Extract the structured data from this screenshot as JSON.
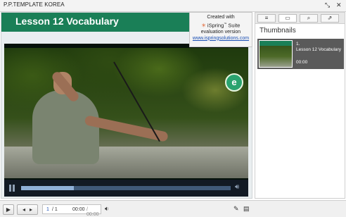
{
  "window": {
    "title": "P.P.TEMPLATE KOREA",
    "expand_icon": "expand-icon",
    "close_icon": "close-icon"
  },
  "slide": {
    "title": "Lesson 12 Vocabulary",
    "video_logo": "e"
  },
  "watermark": {
    "line1": "Created with",
    "brand": "iSpring",
    "brand_suffix": " Suite",
    "line3": "evaluation version",
    "link": "www.ispringsolutions.com"
  },
  "video": {
    "progress": 0.25,
    "pause_icon": "pause-icon",
    "volume_icon": "volume-icon"
  },
  "player": {
    "play_icon": "play-icon",
    "prev_icon": "prev-slide-icon",
    "next_icon": "next-slide-icon",
    "slide_current": "1",
    "slide_total": "/ 1",
    "time_current": "00:00",
    "time_total": "/ 00:00",
    "volume_icon": "volume-icon",
    "pen_icon": "pen-icon",
    "layout_icon": "layout-icon"
  },
  "sidebar": {
    "tabs": [
      {
        "icon": "outline-icon",
        "glyph": "≡"
      },
      {
        "icon": "thumbnails-icon",
        "glyph": "▭"
      },
      {
        "icon": "search-icon",
        "glyph": "⌕"
      },
      {
        "icon": "notes-icon",
        "glyph": "⇗"
      }
    ],
    "title": "Thumbnails",
    "items": [
      {
        "number": "1.",
        "label": "Lesson 12 Vocabulary",
        "duration": "00:00"
      }
    ]
  }
}
